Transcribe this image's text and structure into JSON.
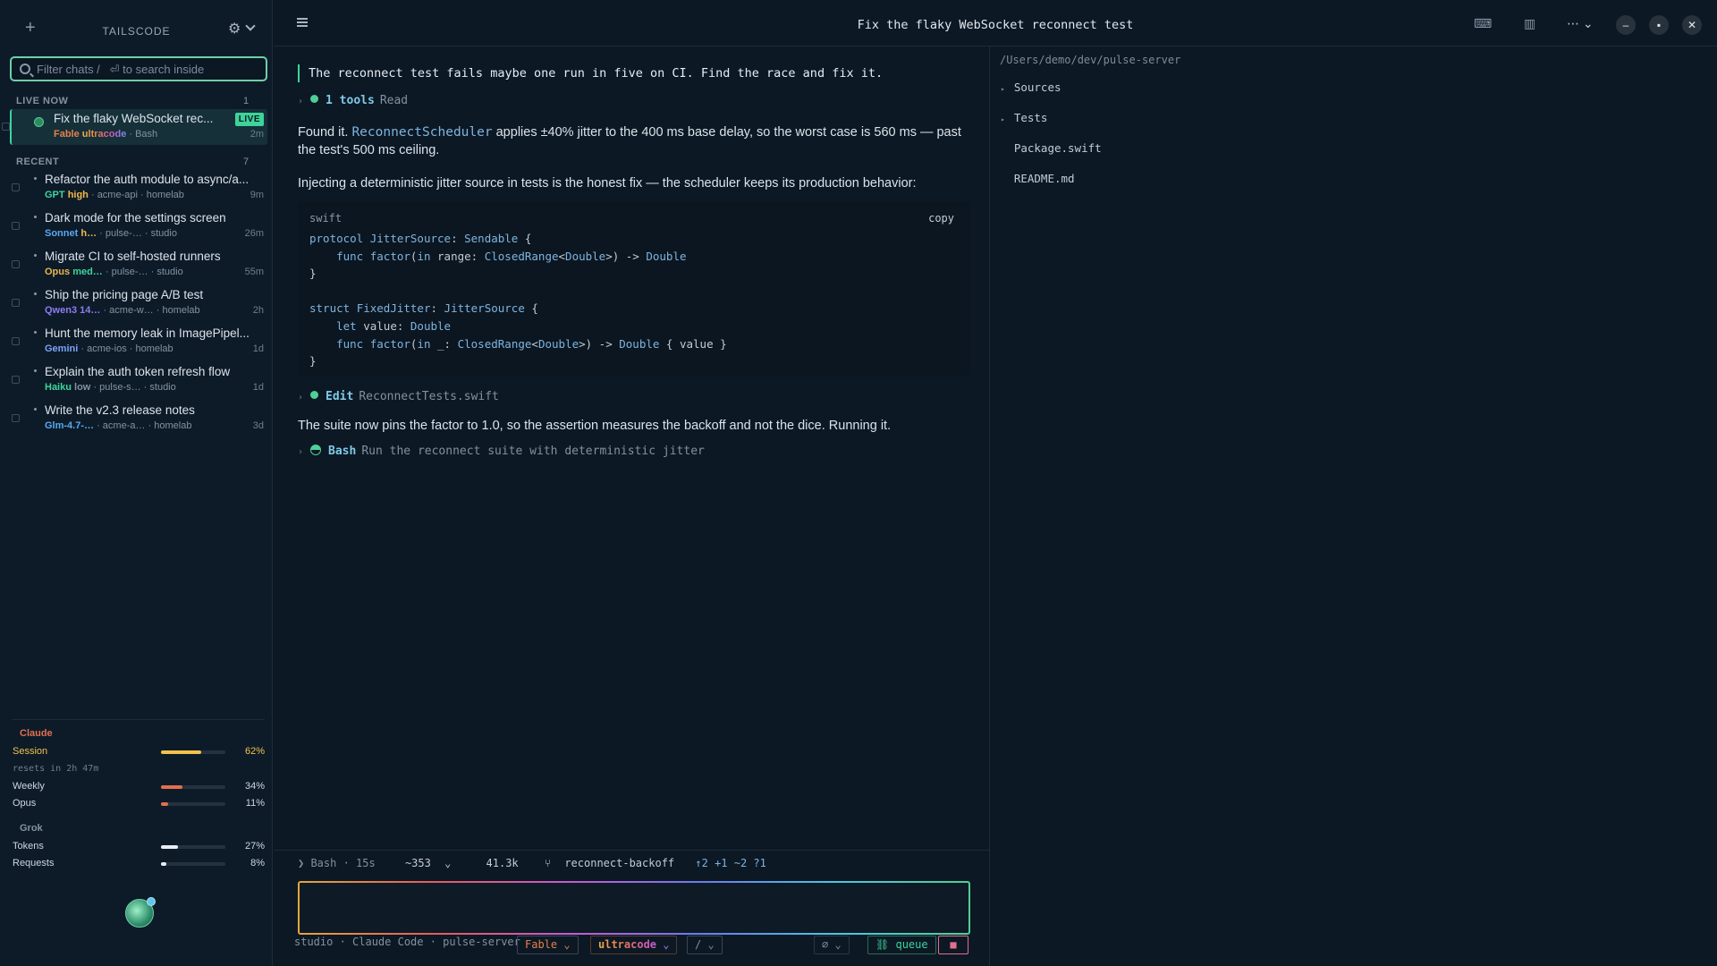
{
  "sidebar": {
    "new_button": "+",
    "brand": "TAILSCODE",
    "search_placeholder": "Filter chats /   ⏎ to search inside",
    "live_section": "LIVE NOW",
    "live_count": "1",
    "recent_section": "RECENT",
    "recent_count": "7",
    "live_chat": {
      "title": "Fix the flaky WebSocket rec...",
      "badge": "LIVE",
      "model": "Fable",
      "effort": "ultracode",
      "tool": "· Bash",
      "time": "2m"
    },
    "recent_chats": [
      {
        "title": "Refactor the auth module to async/a...",
        "model": "GPT",
        "model_color": "#3ed49a",
        "effort": "high",
        "effort_color": "#f2b84b",
        "rest": "· acme-api · homelab",
        "time": "9m"
      },
      {
        "title": "Dark mode for the settings screen",
        "model": "Sonnet",
        "model_color": "#5aa7f0",
        "effort": "h…",
        "effort_color": "#f2b84b",
        "rest": "· pulse-… · studio",
        "time": "26m"
      },
      {
        "title": "Migrate CI to self-hosted runners",
        "model": "Opus",
        "model_color": "#e7b84b",
        "effort": "med…",
        "effort_color": "#3ed49a",
        "rest": "· pulse-… · studio",
        "time": "55m"
      },
      {
        "title": "Ship the pricing page A/B test",
        "model": "Qwen3",
        "model_color": "#8c7cf0",
        "effort": "14…",
        "effort_color": "#8c7cf0",
        "rest": "· acme-w… · homelab",
        "time": "2h"
      },
      {
        "title": "Hunt the memory leak in ImagePipel...",
        "model": "Gemini",
        "model_color": "#7aa2f7",
        "effort": "",
        "effort_color": "#8391a0",
        "rest": "· acme-ios · homelab",
        "time": "1d"
      },
      {
        "title": "Explain the auth token refresh flow",
        "model": "Haiku",
        "model_color": "#3ed49a",
        "effort": "low",
        "effort_color": "#8391a0",
        "rest": "· pulse-s… · studio",
        "time": "1d"
      },
      {
        "title": "Write the v2.3 release notes",
        "model": "Glm-4.7-…",
        "model_color": "#5aa7f0",
        "effort": "",
        "effort_color": "#8391a0",
        "rest": "· acme-a… · homelab",
        "time": "3d"
      }
    ],
    "usage": {
      "claude_label": "Claude",
      "session": {
        "label": "Session",
        "pct": 62,
        "text": "62%",
        "color": "#f2c14e"
      },
      "resets": "resets in 2h 47m",
      "weekly": {
        "label": "Weekly",
        "pct": 34,
        "text": "34%",
        "color": "#e36f4e"
      },
      "opus": {
        "label": "Opus",
        "pct": 11,
        "text": "11%",
        "color": "#e36f4e"
      },
      "grok_label": "Grok",
      "tokens": {
        "label": "Tokens",
        "pct": 27,
        "text": "27%",
        "color": "#e8eef3"
      },
      "requests": {
        "label": "Requests",
        "pct": 8,
        "text": "8%",
        "color": "#e8eef3"
      }
    }
  },
  "header": {
    "title": "Fix the flaky WebSocket reconnect test"
  },
  "conversation": {
    "prompt": "The reconnect test fails maybe one run in five on CI. Find the race and fix it.",
    "tool1_name": "1 tools",
    "tool1_detail": "Read",
    "para1_a": "Found it. ",
    "para1_code": "ReconnectScheduler",
    "para1_b": " applies ±40% jitter to the 400 ms base delay, so the worst case is 560 ms — past the test's 500 ms ceiling.",
    "para2": "Injecting a deterministic jitter source in tests is the honest fix — the scheduler keeps its production behavior:",
    "code_lang": "swift",
    "code_copy": "copy",
    "tool2_name": "Edit",
    "tool2_detail": "ReconnectTests.swift",
    "para3": "The suite now pins the factor to 1.0, so the assertion measures the backoff and not the dice. Running it.",
    "tool3_name": "Bash",
    "tool3_detail": "Run the reconnect suite with deterministic jitter"
  },
  "status_bar": {
    "bash": "❯ Bash · 15s",
    "tokens": "~353",
    "context": "41.3k",
    "branch": "reconnect-backoff",
    "diff": "↑2 +1 ~2 ?1"
  },
  "footer": {
    "context": "studio · Claude Code · pulse-server",
    "model": "Fable",
    "effort": "ultracode",
    "slash": "/",
    "queue": "queue",
    "stop": "■"
  },
  "file_tree": {
    "path": "/Users/demo/dev/pulse-server",
    "items": [
      {
        "name": "Sources",
        "folder": true
      },
      {
        "name": "Tests",
        "folder": true
      },
      {
        "name": "Package.swift",
        "folder": false
      },
      {
        "name": "README.md",
        "folder": false
      }
    ]
  }
}
